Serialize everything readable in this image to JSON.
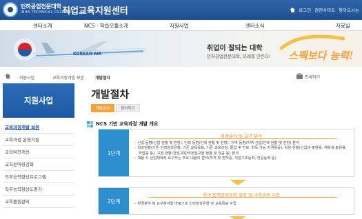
{
  "header": {
    "univ_name": "인하공업전문대학",
    "univ_sub": "INHA TECHNICAL COLLEGE",
    "site_title": "직업교육지원센터",
    "top_links": [
      "로그인",
      "관련사이트",
      "찾아오시는"
    ]
  },
  "main_nav": [
    "센터소개",
    "NCS · 학습모듈소개",
    "지원사업",
    "센터소식",
    "자료실"
  ],
  "banner": {
    "plane_label": "KOREAN AIR",
    "headline": "취업이 잘되는 대학",
    "subline": "인하공업전문대학, 미래를 만든다!",
    "brush_text": "스펙보다 능력!"
  },
  "breadcrumb": [
    "지원사업",
    "교육과정개발 보완",
    "개발절차"
  ],
  "print_label": "인쇄하기",
  "sidebar": {
    "title": "지원사업",
    "items": [
      "교육과정개발 보완",
      "교육과정 운영지원",
      "교육여건개선",
      "교직원역량강화",
      "직무능력향상프로그램",
      "직무능력향상도평가",
      "교육품질관리"
    ],
    "active_index": 0
  },
  "content": {
    "title": "개발절차",
    "tabs": [
      "개발절차",
      "참여학과"
    ],
    "active_tab": 0,
    "section_title": "NCS 기반 교육과정 개발 개요",
    "steps": [
      {
        "label": "1단계",
        "heading": "환경분석 및 요구 분석",
        "items": [
          "산업 동향(산업 현황 및 전망), 인력 동향(인력 현황 및 전망), 지역 동향(지역 산업/인력 현황 및 전망) 분석",
          "학과현황(기존 인력양성유형, 기존 교육목표, 기존 교육과정, 졸업 후 진로, 취득 가능 자격증등), 학생 현황(신입생 충원률, 재학생 충원률, 취업률 등), 교원 현황(전임교원/비전임교원 현황 및 전공 등) 분석",
          "채용 시 산업체에서 요구하는 주요 내용의 분석(자격 및 면허증, 직업기초능력, 전공능력 등)"
        ]
      },
      {
        "label": "2단계",
        "heading": "학과 인력양성유형 설정 및 교육목표 수립",
        "items": [
          "환경분석 및 요구분석을 바탕으로 인력양성유형 및 교육목표 수립"
        ]
      }
    ]
  },
  "colors": {
    "header_blue": "#1f4f93",
    "accent_orange": "#f2a33a",
    "step_blue": "#2e8fcf"
  }
}
